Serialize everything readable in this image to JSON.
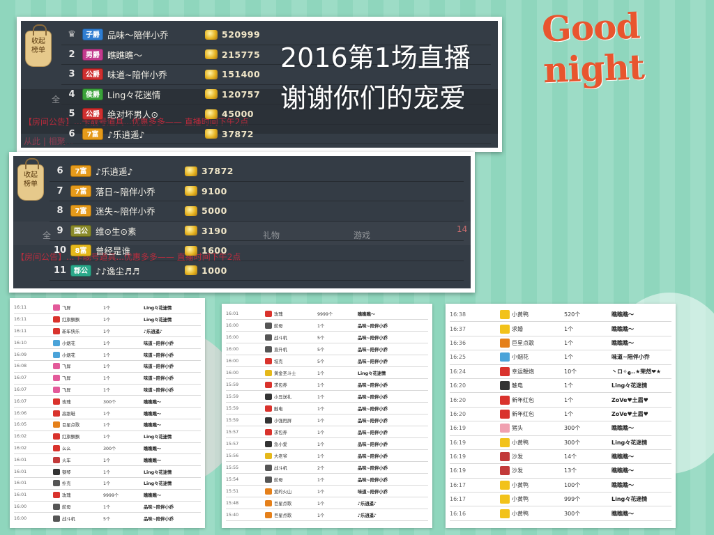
{
  "colors": {
    "accent": "#e8552e",
    "panel_bg": "#343c45"
  },
  "greeting": "Good night",
  "overlay": {
    "line1": "2016第1场直播",
    "line2": "谢谢你们的宠爱"
  },
  "collapse_tag": {
    "label1": "收起",
    "label2": "榜单",
    "arrow": "︿"
  },
  "rankboard_top": [
    {
      "rank": "1",
      "badge": "子爵",
      "badge_color": "#2f7dd1",
      "name": "品味～陪伴小乔",
      "score": "520999",
      "icon": "trophy-icon"
    },
    {
      "rank": "2",
      "badge": "男爵",
      "badge_color": "#c23a8d",
      "name": "瞧瞧瞧～",
      "score": "215775"
    },
    {
      "rank": "3",
      "badge": "公爵",
      "badge_color": "#cf2f2f",
      "name": "味道~陪伴小乔",
      "score": "151400"
    },
    {
      "rank": "4",
      "badge": "侯爵",
      "badge_color": "#3aa23a",
      "name": "Ling々花迷情",
      "score": "120757"
    },
    {
      "rank": "5",
      "badge": "公爵",
      "badge_color": "#cf2f2f",
      "name": "绝对坏男人⊙",
      "score": "45000"
    },
    {
      "rank": "6",
      "badge": "7富",
      "badge_color": "#e59a1a",
      "name": "♪乐逍遥♪",
      "score": "37872"
    }
  ],
  "rankboard_bottom": [
    {
      "rank": "6",
      "badge": "7富",
      "badge_color": "#e59a1a",
      "name": "♪乐逍遥♪",
      "score": "37872"
    },
    {
      "rank": "7",
      "badge": "7富",
      "badge_color": "#e59a1a",
      "name": "落日~陪伴小乔",
      "score": "9100"
    },
    {
      "rank": "8",
      "badge": "7富",
      "badge_color": "#e59a1a",
      "name": "迷失~陪伴小乔",
      "score": "5000"
    },
    {
      "rank": "9",
      "badge": "国公",
      "badge_color": "#8a8a2a",
      "name": "维⊙生⊙素",
      "score": "3190"
    },
    {
      "rank": "10",
      "badge": "8富",
      "badge_color": "#e5b81a",
      "name": "曾经是谁",
      "score": "1600"
    },
    {
      "rank": "11",
      "badge": "郡公",
      "badge_color": "#2aa88a",
      "name": "♪♪逸尘♬♬",
      "score": "1000"
    }
  ],
  "background_ghost": {
    "tab_all": "全",
    "tab_gift": "礼物",
    "tab_game": "游戏",
    "badge_count": "14",
    "notice": "【房间公告】...卡靓号道具...优惠多多—— 直播时间下午2点",
    "from": "从此 | 相聚..."
  },
  "gift_log_1": [
    {
      "time": "16:11",
      "gift": "飞屏",
      "qty": "1个",
      "user": "Ling々花迷情",
      "color": "#e35a9a"
    },
    {
      "time": "16:11",
      "gift": "红旗飘飘",
      "qty": "1个",
      "user": "Ling々花迷情",
      "color": "#d9322c"
    },
    {
      "time": "16:11",
      "gift": "新年快乐",
      "qty": "1个",
      "user": "♪乐逍遥♪",
      "color": "#d9322c"
    },
    {
      "time": "16:10",
      "gift": "小烟花",
      "qty": "1个",
      "user": "味道~陪伴小乔",
      "color": "#4aa3d9"
    },
    {
      "time": "16:09",
      "gift": "小烟花",
      "qty": "1个",
      "user": "味道~陪伴小乔",
      "color": "#4aa3d9"
    },
    {
      "time": "16:08",
      "gift": "飞屏",
      "qty": "1个",
      "user": "味道~陪伴小乔",
      "color": "#e35a9a"
    },
    {
      "time": "16:07",
      "gift": "飞屏",
      "qty": "1个",
      "user": "味道~陪伴小乔",
      "color": "#e35a9a"
    },
    {
      "time": "16:07",
      "gift": "飞屏",
      "qty": "1个",
      "user": "味道~陪伴小乔",
      "color": "#e35a9a"
    },
    {
      "time": "16:07",
      "gift": "玫瑰",
      "qty": "300个",
      "user": "瞧瞧瞧～",
      "color": "#d9322c"
    },
    {
      "time": "16:06",
      "gift": "高跟鞋",
      "qty": "1个",
      "user": "瞧瞧瞧～",
      "color": "#d9322c"
    },
    {
      "time": "16:05",
      "gift": "巨星点歌",
      "qty": "1个",
      "user": "瞧瞧瞧～",
      "color": "#e5801a"
    },
    {
      "time": "16:02",
      "gift": "红旗飘飘",
      "qty": "1个",
      "user": "Ling々花迷情",
      "color": "#d9322c"
    },
    {
      "time": "16:02",
      "gift": "么么",
      "qty": "300个",
      "user": "瞧瞧瞧～",
      "color": "#d9322c"
    },
    {
      "time": "16:01",
      "gift": "火车",
      "qty": "1个",
      "user": "瞧瞧瞧～",
      "color": "#c23a3a"
    },
    {
      "time": "16:01",
      "gift": "钢琴",
      "qty": "1个",
      "user": "Ling々花迷情",
      "color": "#333333"
    },
    {
      "time": "16:01",
      "gift": "扑克",
      "qty": "1个",
      "user": "Ling々花迷情",
      "color": "#555555"
    },
    {
      "time": "16:01",
      "gift": "玫瑰",
      "qty": "9999个",
      "user": "瞧瞧瞧～",
      "color": "#d9322c"
    },
    {
      "time": "16:00",
      "gift": "航母",
      "qty": "1个",
      "user": "品味~陪伴小乔",
      "color": "#555555"
    },
    {
      "time": "16:00",
      "gift": "战斗机",
      "qty": "5个",
      "user": "品味~陪伴小乔",
      "color": "#555555"
    }
  ],
  "gift_log_2": [
    {
      "time": "16:01",
      "gift": "玫瑰",
      "qty": "9999个",
      "user": "瞧瞧瞧～",
      "color": "#d9322c"
    },
    {
      "time": "16:00",
      "gift": "航母",
      "qty": "1个",
      "user": "品味~陪伴小乔",
      "color": "#555555"
    },
    {
      "time": "16:00",
      "gift": "战斗机",
      "qty": "5个",
      "user": "品味~陪伴小乔",
      "color": "#555555"
    },
    {
      "time": "16:00",
      "gift": "直升机",
      "qty": "5个",
      "user": "品味~陪伴小乔",
      "color": "#555555"
    },
    {
      "time": "16:00",
      "gift": "坦克",
      "qty": "5个",
      "user": "品味~陪伴小乔",
      "color": "#d9322c"
    },
    {
      "time": "16:00",
      "gift": "黄金圣斗士",
      "qty": "1个",
      "user": "Ling々花迷情",
      "color": "#e5b81a"
    },
    {
      "time": "15:59",
      "gift": "求包养",
      "qty": "1个",
      "user": "品味~陪伴小乔",
      "color": "#d9322c"
    },
    {
      "time": "15:59",
      "gift": "小丑送礼",
      "qty": "1个",
      "user": "品味~陪伴小乔",
      "color": "#333333"
    },
    {
      "time": "15:59",
      "gift": "触电",
      "qty": "1个",
      "user": "品味~陪伴小乔",
      "color": "#d9322c"
    },
    {
      "time": "15:59",
      "gift": "小强甩屏",
      "qty": "1个",
      "user": "品味~陪伴小乔",
      "color": "#333333"
    },
    {
      "time": "15:57",
      "gift": "求包养",
      "qty": "1个",
      "user": "品味~陪伴小乔",
      "color": "#d9322c"
    },
    {
      "time": "15:57",
      "gift": "急小爱",
      "qty": "1个",
      "user": "品味~陪伴小乔",
      "color": "#333333"
    },
    {
      "time": "15:56",
      "gift": "大老爷",
      "qty": "1个",
      "user": "品味~陪伴小乔",
      "color": "#e5b81a"
    },
    {
      "time": "15:55",
      "gift": "战斗机",
      "qty": "2个",
      "user": "品味~陪伴小乔",
      "color": "#555555"
    },
    {
      "time": "15:54",
      "gift": "航母",
      "qty": "1个",
      "user": "品味~陪伴小乔",
      "color": "#555555"
    },
    {
      "time": "15:51",
      "gift": "爱的火山",
      "qty": "1个",
      "user": "味道~陪伴小乔",
      "color": "#e5801a"
    },
    {
      "time": "15:48",
      "gift": "巨星点歌",
      "qty": "1个",
      "user": "♪乐逍遥♪",
      "color": "#e5801a"
    },
    {
      "time": "15:40",
      "gift": "巨星点歌",
      "qty": "1个",
      "user": "♪乐逍遥♪",
      "color": "#e5801a"
    }
  ],
  "gift_log_3": [
    {
      "time": "16:38",
      "gift": "小黄鸭",
      "qty": "520个",
      "user": "瞧瞧瞧～",
      "color": "#f2c21a"
    },
    {
      "time": "16:37",
      "gift": "求婚",
      "qty": "1个",
      "user": "瞧瞧瞧～",
      "color": "#f2c21a"
    },
    {
      "time": "16:36",
      "gift": "巨星点歌",
      "qty": "1个",
      "user": "瞧瞧瞧～",
      "color": "#e5801a"
    },
    {
      "time": "16:25",
      "gift": "小烟花",
      "qty": "1个",
      "user": "味道~陪伴小乔",
      "color": "#4aa3d9"
    },
    {
      "time": "16:24",
      "gift": "幸运鞭炮",
      "qty": "10个",
      "user": "丶ロ✧ﻬ..★荣然❤★",
      "color": "#d9322c"
    },
    {
      "time": "16:20",
      "gift": "触电",
      "qty": "1个",
      "user": "Ling々花迷情",
      "color": "#333333"
    },
    {
      "time": "16:20",
      "gift": "新年红包",
      "qty": "1个",
      "user": "ZoVe♥土眉♥",
      "color": "#d9322c"
    },
    {
      "time": "16:20",
      "gift": "新年红包",
      "qty": "1个",
      "user": "ZoVe♥土眉♥",
      "color": "#d9322c"
    },
    {
      "time": "16:19",
      "gift": "猪头",
      "qty": "300个",
      "user": "瞧瞧瞧～",
      "color": "#f0a0b0"
    },
    {
      "time": "16:19",
      "gift": "小黄鸭",
      "qty": "300个",
      "user": "Ling々花迷情",
      "color": "#f2c21a"
    },
    {
      "time": "16:19",
      "gift": "沙发",
      "qty": "14个",
      "user": "瞧瞧瞧～",
      "color": "#c23a3a"
    },
    {
      "time": "16:19",
      "gift": "沙发",
      "qty": "13个",
      "user": "瞧瞧瞧～",
      "color": "#c23a3a"
    },
    {
      "time": "16:17",
      "gift": "小黄鸭",
      "qty": "100个",
      "user": "瞧瞧瞧～",
      "color": "#f2c21a"
    },
    {
      "time": "16:17",
      "gift": "小黄鸭",
      "qty": "999个",
      "user": "Ling々花迷情",
      "color": "#f2c21a"
    },
    {
      "time": "16:16",
      "gift": "小黄鸭",
      "qty": "300个",
      "user": "瞧瞧瞧～",
      "color": "#f2c21a"
    }
  ]
}
